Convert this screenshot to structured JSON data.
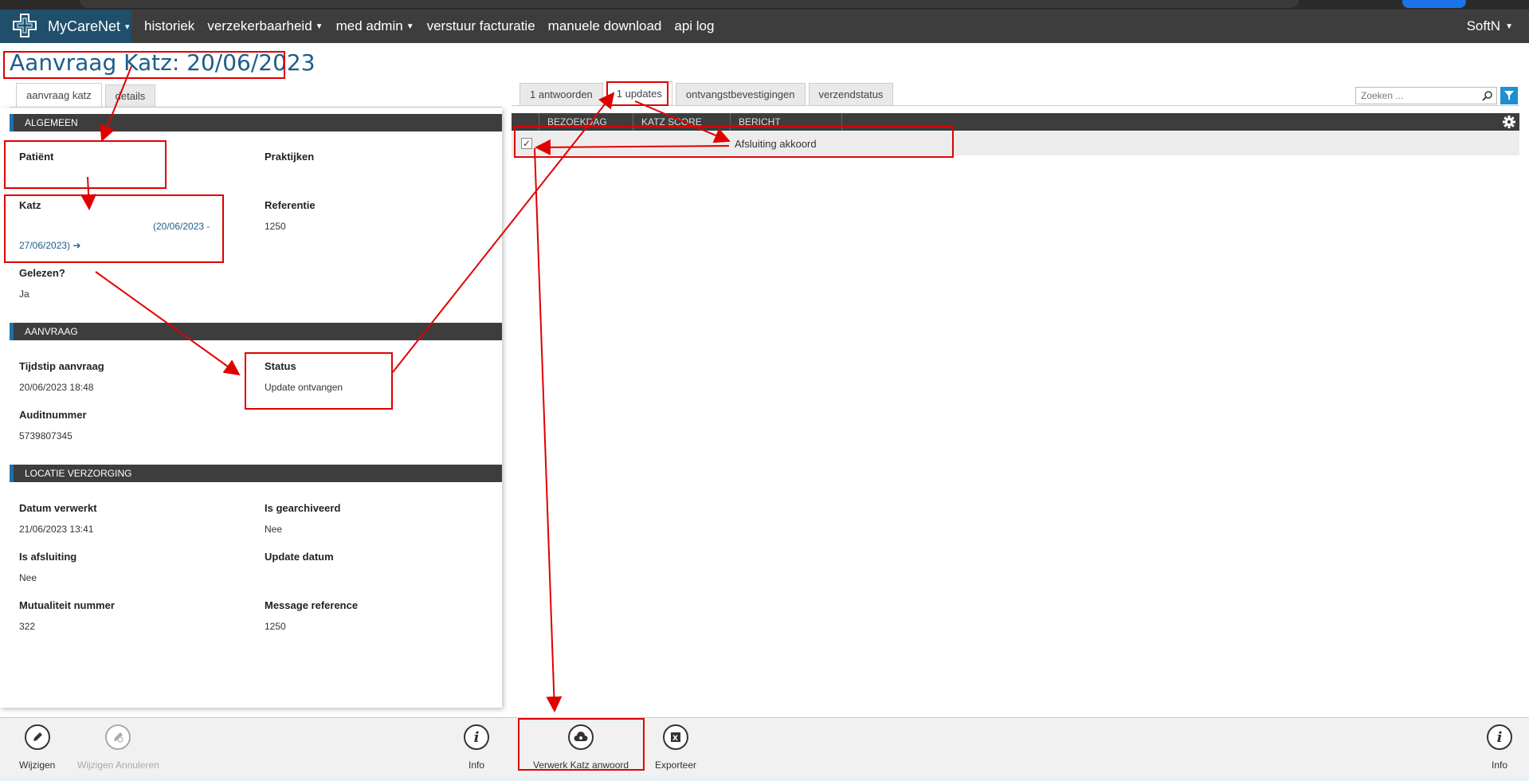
{
  "nav": {
    "brand": "MyCareNet",
    "items": [
      {
        "label": "historiek",
        "caret": false
      },
      {
        "label": "verzekerbaarheid",
        "caret": true
      },
      {
        "label": "med admin",
        "caret": true
      },
      {
        "label": "verstuur facturatie",
        "caret": false
      },
      {
        "label": "manuele download",
        "caret": false
      },
      {
        "label": "api log",
        "caret": false
      }
    ],
    "user": "SoftN"
  },
  "page_title": "Aanvraag Katz: 20/06/2023",
  "left_tabs": [
    "aanvraag katz",
    "details"
  ],
  "right_tabs": [
    "1 antwoorden",
    "1 updates",
    "ontvangstbevestigingen",
    "verzendstatus"
  ],
  "sections": {
    "algemeen": "ALGEMEEN",
    "aanvraag": "AANVRAAG",
    "locatie": "LOCATIE VERZORGING"
  },
  "fields": {
    "patient_label": "Patiënt",
    "praktijken_label": "Praktijken",
    "katz_label": "Katz",
    "katz_value_1": "(20/06/2023 -",
    "katz_value_2": "27/06/2023)",
    "referentie_label": "Referentie",
    "referentie_value": "1250",
    "gelezen_label": "Gelezen?",
    "gelezen_value": "Ja",
    "tijdstip_label": "Tijdstip aanvraag",
    "tijdstip_value": "20/06/2023 18:48",
    "status_label": "Status",
    "status_value": "Update ontvangen",
    "audit_label": "Auditnummer",
    "audit_value": "5739807345",
    "datum_verwerkt_label": "Datum verwerkt",
    "datum_verwerkt_value": "21/06/2023 13:41",
    "gearchiveerd_label": "Is gearchiveerd",
    "gearchiveerd_value": "Nee",
    "afsluiting_label": "Is afsluiting",
    "afsluiting_value": "Nee",
    "update_datum_label": "Update datum",
    "mutualiteit_label": "Mutualiteit nummer",
    "mutualiteit_value": "322",
    "message_ref_label": "Message reference",
    "message_ref_value": "1250"
  },
  "grid": {
    "columns": [
      "BEZOEKDAG",
      "KATZ SCORE",
      "BERICHT"
    ],
    "rows": [
      {
        "checked": true,
        "bericht": "Afsluiting akkoord"
      }
    ]
  },
  "search": {
    "placeholder": "Zoeken ..."
  },
  "toolbar": {
    "wijzigen": "Wijzigen",
    "wijzigen_annuleren": "Wijzigen Annuleren",
    "info": "Info",
    "verwerk": "Verwerk Katz anwoord",
    "exporteer": "Exporteer",
    "info_right": "Info"
  },
  "colors": {
    "annotation": "#e00000",
    "nav_bg": "#3d3d3d",
    "brand_bg": "#1f4f6b",
    "title": "#1b5e8a",
    "filter": "#1f8fd1"
  }
}
